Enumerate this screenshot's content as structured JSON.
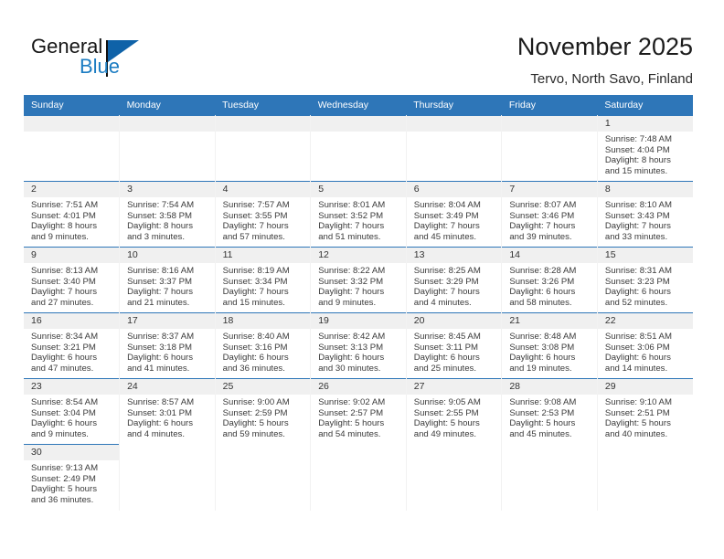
{
  "brand": {
    "name_part1": "General",
    "name_part2": "Blue",
    "accent_color": "#1b7cc2",
    "triangle_color": "#0f62a8"
  },
  "header": {
    "title": "November 2025",
    "subtitle": "Tervo, North Savo, Finland",
    "header_bg": "#2e76b8",
    "daynum_bg": "#f0f0f0"
  },
  "weekdays": [
    "Sunday",
    "Monday",
    "Tuesday",
    "Wednesday",
    "Thursday",
    "Friday",
    "Saturday"
  ],
  "labels": {
    "sunrise": "Sunrise:",
    "sunset": "Sunset:",
    "daylight": "Daylight:"
  },
  "weeks": [
    [
      {
        "day": "",
        "empty": true
      },
      {
        "day": "",
        "empty": true
      },
      {
        "day": "",
        "empty": true
      },
      {
        "day": "",
        "empty": true
      },
      {
        "day": "",
        "empty": true
      },
      {
        "day": "",
        "empty": true
      },
      {
        "day": "1",
        "sunrise": "Sunrise: 7:48 AM",
        "sunset": "Sunset: 4:04 PM",
        "daylight1": "Daylight: 8 hours",
        "daylight2": "and 15 minutes."
      }
    ],
    [
      {
        "day": "2",
        "sunrise": "Sunrise: 7:51 AM",
        "sunset": "Sunset: 4:01 PM",
        "daylight1": "Daylight: 8 hours",
        "daylight2": "and 9 minutes."
      },
      {
        "day": "3",
        "sunrise": "Sunrise: 7:54 AM",
        "sunset": "Sunset: 3:58 PM",
        "daylight1": "Daylight: 8 hours",
        "daylight2": "and 3 minutes."
      },
      {
        "day": "4",
        "sunrise": "Sunrise: 7:57 AM",
        "sunset": "Sunset: 3:55 PM",
        "daylight1": "Daylight: 7 hours",
        "daylight2": "and 57 minutes."
      },
      {
        "day": "5",
        "sunrise": "Sunrise: 8:01 AM",
        "sunset": "Sunset: 3:52 PM",
        "daylight1": "Daylight: 7 hours",
        "daylight2": "and 51 minutes."
      },
      {
        "day": "6",
        "sunrise": "Sunrise: 8:04 AM",
        "sunset": "Sunset: 3:49 PM",
        "daylight1": "Daylight: 7 hours",
        "daylight2": "and 45 minutes."
      },
      {
        "day": "7",
        "sunrise": "Sunrise: 8:07 AM",
        "sunset": "Sunset: 3:46 PM",
        "daylight1": "Daylight: 7 hours",
        "daylight2": "and 39 minutes."
      },
      {
        "day": "8",
        "sunrise": "Sunrise: 8:10 AM",
        "sunset": "Sunset: 3:43 PM",
        "daylight1": "Daylight: 7 hours",
        "daylight2": "and 33 minutes."
      }
    ],
    [
      {
        "day": "9",
        "sunrise": "Sunrise: 8:13 AM",
        "sunset": "Sunset: 3:40 PM",
        "daylight1": "Daylight: 7 hours",
        "daylight2": "and 27 minutes."
      },
      {
        "day": "10",
        "sunrise": "Sunrise: 8:16 AM",
        "sunset": "Sunset: 3:37 PM",
        "daylight1": "Daylight: 7 hours",
        "daylight2": "and 21 minutes."
      },
      {
        "day": "11",
        "sunrise": "Sunrise: 8:19 AM",
        "sunset": "Sunset: 3:34 PM",
        "daylight1": "Daylight: 7 hours",
        "daylight2": "and 15 minutes."
      },
      {
        "day": "12",
        "sunrise": "Sunrise: 8:22 AM",
        "sunset": "Sunset: 3:32 PM",
        "daylight1": "Daylight: 7 hours",
        "daylight2": "and 9 minutes."
      },
      {
        "day": "13",
        "sunrise": "Sunrise: 8:25 AM",
        "sunset": "Sunset: 3:29 PM",
        "daylight1": "Daylight: 7 hours",
        "daylight2": "and 4 minutes."
      },
      {
        "day": "14",
        "sunrise": "Sunrise: 8:28 AM",
        "sunset": "Sunset: 3:26 PM",
        "daylight1": "Daylight: 6 hours",
        "daylight2": "and 58 minutes."
      },
      {
        "day": "15",
        "sunrise": "Sunrise: 8:31 AM",
        "sunset": "Sunset: 3:23 PM",
        "daylight1": "Daylight: 6 hours",
        "daylight2": "and 52 minutes."
      }
    ],
    [
      {
        "day": "16",
        "sunrise": "Sunrise: 8:34 AM",
        "sunset": "Sunset: 3:21 PM",
        "daylight1": "Daylight: 6 hours",
        "daylight2": "and 47 minutes."
      },
      {
        "day": "17",
        "sunrise": "Sunrise: 8:37 AM",
        "sunset": "Sunset: 3:18 PM",
        "daylight1": "Daylight: 6 hours",
        "daylight2": "and 41 minutes."
      },
      {
        "day": "18",
        "sunrise": "Sunrise: 8:40 AM",
        "sunset": "Sunset: 3:16 PM",
        "daylight1": "Daylight: 6 hours",
        "daylight2": "and 36 minutes."
      },
      {
        "day": "19",
        "sunrise": "Sunrise: 8:42 AM",
        "sunset": "Sunset: 3:13 PM",
        "daylight1": "Daylight: 6 hours",
        "daylight2": "and 30 minutes."
      },
      {
        "day": "20",
        "sunrise": "Sunrise: 8:45 AM",
        "sunset": "Sunset: 3:11 PM",
        "daylight1": "Daylight: 6 hours",
        "daylight2": "and 25 minutes."
      },
      {
        "day": "21",
        "sunrise": "Sunrise: 8:48 AM",
        "sunset": "Sunset: 3:08 PM",
        "daylight1": "Daylight: 6 hours",
        "daylight2": "and 19 minutes."
      },
      {
        "day": "22",
        "sunrise": "Sunrise: 8:51 AM",
        "sunset": "Sunset: 3:06 PM",
        "daylight1": "Daylight: 6 hours",
        "daylight2": "and 14 minutes."
      }
    ],
    [
      {
        "day": "23",
        "sunrise": "Sunrise: 8:54 AM",
        "sunset": "Sunset: 3:04 PM",
        "daylight1": "Daylight: 6 hours",
        "daylight2": "and 9 minutes."
      },
      {
        "day": "24",
        "sunrise": "Sunrise: 8:57 AM",
        "sunset": "Sunset: 3:01 PM",
        "daylight1": "Daylight: 6 hours",
        "daylight2": "and 4 minutes."
      },
      {
        "day": "25",
        "sunrise": "Sunrise: 9:00 AM",
        "sunset": "Sunset: 2:59 PM",
        "daylight1": "Daylight: 5 hours",
        "daylight2": "and 59 minutes."
      },
      {
        "day": "26",
        "sunrise": "Sunrise: 9:02 AM",
        "sunset": "Sunset: 2:57 PM",
        "daylight1": "Daylight: 5 hours",
        "daylight2": "and 54 minutes."
      },
      {
        "day": "27",
        "sunrise": "Sunrise: 9:05 AM",
        "sunset": "Sunset: 2:55 PM",
        "daylight1": "Daylight: 5 hours",
        "daylight2": "and 49 minutes."
      },
      {
        "day": "28",
        "sunrise": "Sunrise: 9:08 AM",
        "sunset": "Sunset: 2:53 PM",
        "daylight1": "Daylight: 5 hours",
        "daylight2": "and 45 minutes."
      },
      {
        "day": "29",
        "sunrise": "Sunrise: 9:10 AM",
        "sunset": "Sunset: 2:51 PM",
        "daylight1": "Daylight: 5 hours",
        "daylight2": "and 40 minutes."
      }
    ],
    [
      {
        "day": "30",
        "sunrise": "Sunrise: 9:13 AM",
        "sunset": "Sunset: 2:49 PM",
        "daylight1": "Daylight: 5 hours",
        "daylight2": "and 36 minutes."
      },
      {
        "day": "",
        "blank": true
      },
      {
        "day": "",
        "blank": true
      },
      {
        "day": "",
        "blank": true
      },
      {
        "day": "",
        "blank": true
      },
      {
        "day": "",
        "blank": true
      },
      {
        "day": "",
        "blank": true
      }
    ]
  ]
}
